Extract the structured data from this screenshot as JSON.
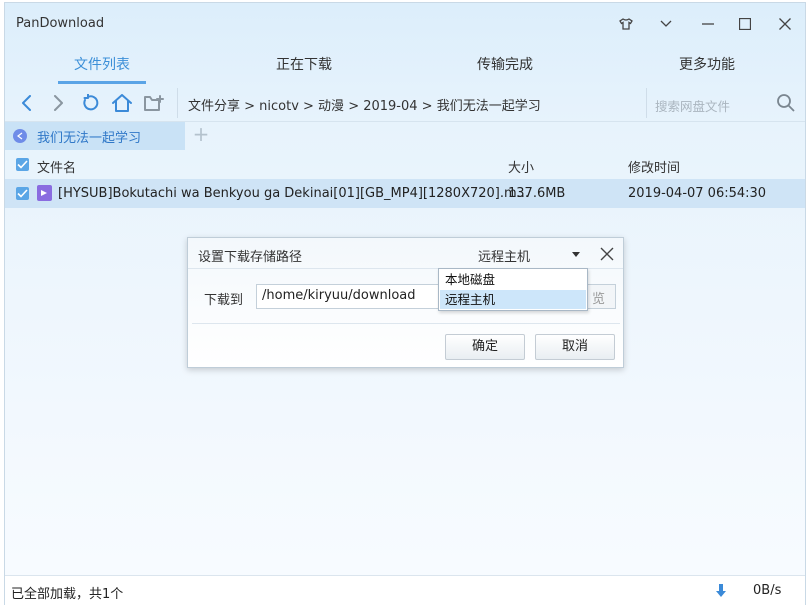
{
  "app": {
    "title": "PanDownload"
  },
  "tabs": [
    {
      "label": "文件列表"
    },
    {
      "label": "正在下载"
    },
    {
      "label": "传输完成"
    },
    {
      "label": "更多功能"
    }
  ],
  "breadcrumb": "文件分享 > nicotv > 动漫 > 2019-04 > 我们无法一起学习",
  "search": {
    "placeholder": "搜索网盘文件"
  },
  "subtab": {
    "label": "我们无法一起学习",
    "add": "+"
  },
  "columns": {
    "name": "文件名",
    "size": "大小",
    "modified": "修改时间"
  },
  "files": [
    {
      "name": "[HYSUB]Bokutachi wa Benkyou ga Dekinai[01][GB_MP4][1280X720].m...",
      "size": "137.6MB",
      "modified": "2019-04-07 06:54:30"
    }
  ],
  "status": {
    "text": "已全部加载，共1个",
    "speed": "0B/s"
  },
  "dialog": {
    "title": "设置下载存储路径",
    "mode": "远程主机",
    "label": "下载到",
    "path": "/home/kiryuu/download",
    "browse": "览",
    "ok": "确定",
    "cancel": "取消",
    "options": [
      "本地磁盘",
      "远程主机"
    ]
  },
  "colors": {
    "accent": "#3c8fd8",
    "selection": "#cfe4f6",
    "dropdown_selected": "#cde6fa"
  }
}
